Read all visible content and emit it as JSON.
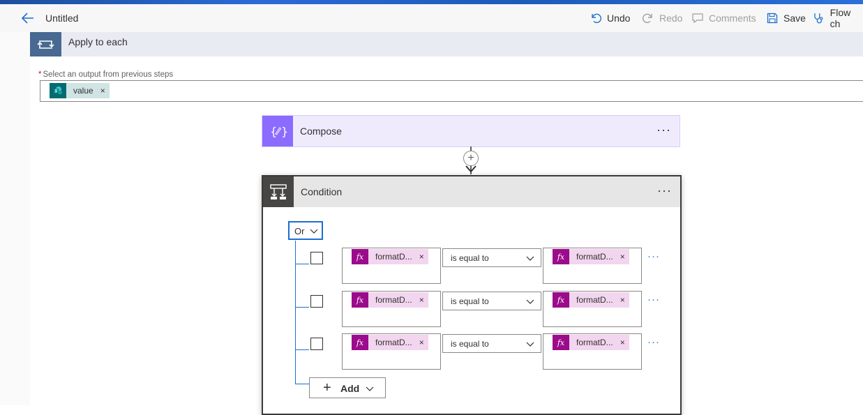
{
  "header": {
    "title": "Untitled",
    "undo_label": "Undo",
    "redo_label": "Redo",
    "comments_label": "Comments",
    "save_label": "Save",
    "flow_checker_label": "Flow ch"
  },
  "apply_to_each": {
    "title": "Apply to each",
    "field_required_mark": "*",
    "field_label": "Select an output from previous steps",
    "token_label": "value",
    "token_remove": "×"
  },
  "compose": {
    "title": "Compose",
    "more": "···"
  },
  "connector": {
    "plus": "+"
  },
  "condition": {
    "title": "Condition",
    "more": "···",
    "group_operator": "Or",
    "rows": [
      {
        "left_token": "formatD...",
        "operator": "is equal to",
        "right_token": "formatD...",
        "remove": "×",
        "more": "···"
      },
      {
        "left_token": "formatD...",
        "operator": "is equal to",
        "right_token": "formatD...",
        "remove": "×",
        "more": "···"
      },
      {
        "left_token": "formatD...",
        "operator": "is equal to",
        "right_token": "formatD...",
        "remove": "×",
        "more": "···"
      }
    ],
    "add_plus": "+",
    "add_label": "Add",
    "fx_symbol": "fx"
  },
  "colors": {
    "accent": "#1c6fd1",
    "apply_icon_bg": "#486991",
    "compose_icon_bg": "#8c6cff",
    "condition_icon_bg": "#484644",
    "fx_token_bg": "#f2d5ee",
    "fx_icon_bg": "#9b0b8b",
    "sharepoint_token_bg": "#cfe4e3",
    "sharepoint_icon_bg": "#036c70"
  }
}
